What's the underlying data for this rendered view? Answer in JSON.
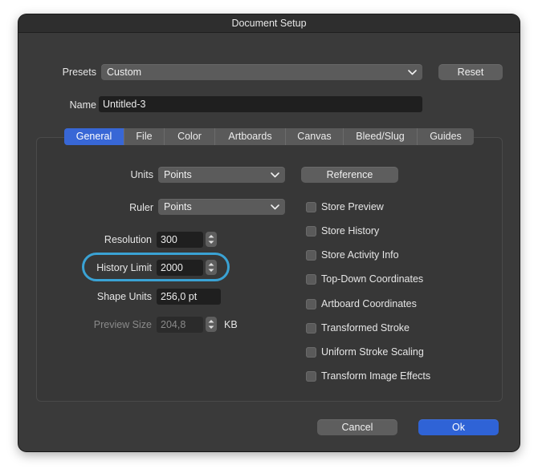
{
  "window": {
    "title": "Document Setup"
  },
  "presets": {
    "label": "Presets",
    "value": "Custom",
    "reset_label": "Reset"
  },
  "name": {
    "label": "Name",
    "value": "Untitled-3"
  },
  "tabs": [
    {
      "label": "General",
      "active": true
    },
    {
      "label": "File"
    },
    {
      "label": "Color"
    },
    {
      "label": "Artboards"
    },
    {
      "label": "Canvas"
    },
    {
      "label": "Bleed/Slug"
    },
    {
      "label": "Guides"
    }
  ],
  "general": {
    "units": {
      "label": "Units",
      "value": "Points"
    },
    "ruler": {
      "label": "Ruler",
      "value": "Points"
    },
    "reference_label": "Reference",
    "resolution": {
      "label": "Resolution",
      "value": "300"
    },
    "history_limit": {
      "label": "History Limit",
      "value": "2000"
    },
    "shape_units": {
      "label": "Shape Units",
      "value": "256,0 pt"
    },
    "preview_size": {
      "label": "Preview Size",
      "value": "204,8",
      "unit": "KB"
    },
    "checkboxes": [
      {
        "label": "Store Preview",
        "checked": false
      },
      {
        "label": "Store History",
        "checked": false
      },
      {
        "label": "Store Activity Info",
        "checked": false
      },
      {
        "label": "Top-Down Coordinates",
        "checked": false
      },
      {
        "label": "Artboard Coordinates",
        "checked": false
      },
      {
        "label": "Transformed Stroke",
        "checked": false
      },
      {
        "label": "Uniform Stroke Scaling",
        "checked": false
      },
      {
        "label": "Transform Image Effects",
        "checked": false
      }
    ]
  },
  "footer": {
    "cancel_label": "Cancel",
    "ok_label": "Ok"
  },
  "colors": {
    "accent": "#3867d6",
    "highlight_ring": "#3aa2d4"
  },
  "icons": {
    "popup": "chevron-down-icon",
    "stepper": "up-down-arrows-icon"
  }
}
